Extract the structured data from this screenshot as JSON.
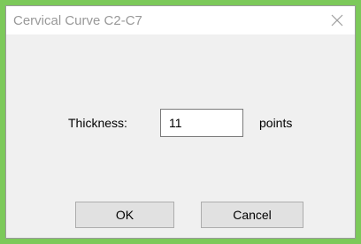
{
  "window": {
    "title": "Cervical Curve C2-C7",
    "close_icon": "close-icon",
    "frame_color": "#7cc95a"
  },
  "form": {
    "thickness_label": "Thickness:",
    "thickness_value": "11",
    "units_label": "points"
  },
  "buttons": {
    "ok_label": "OK",
    "cancel_label": "Cancel"
  }
}
